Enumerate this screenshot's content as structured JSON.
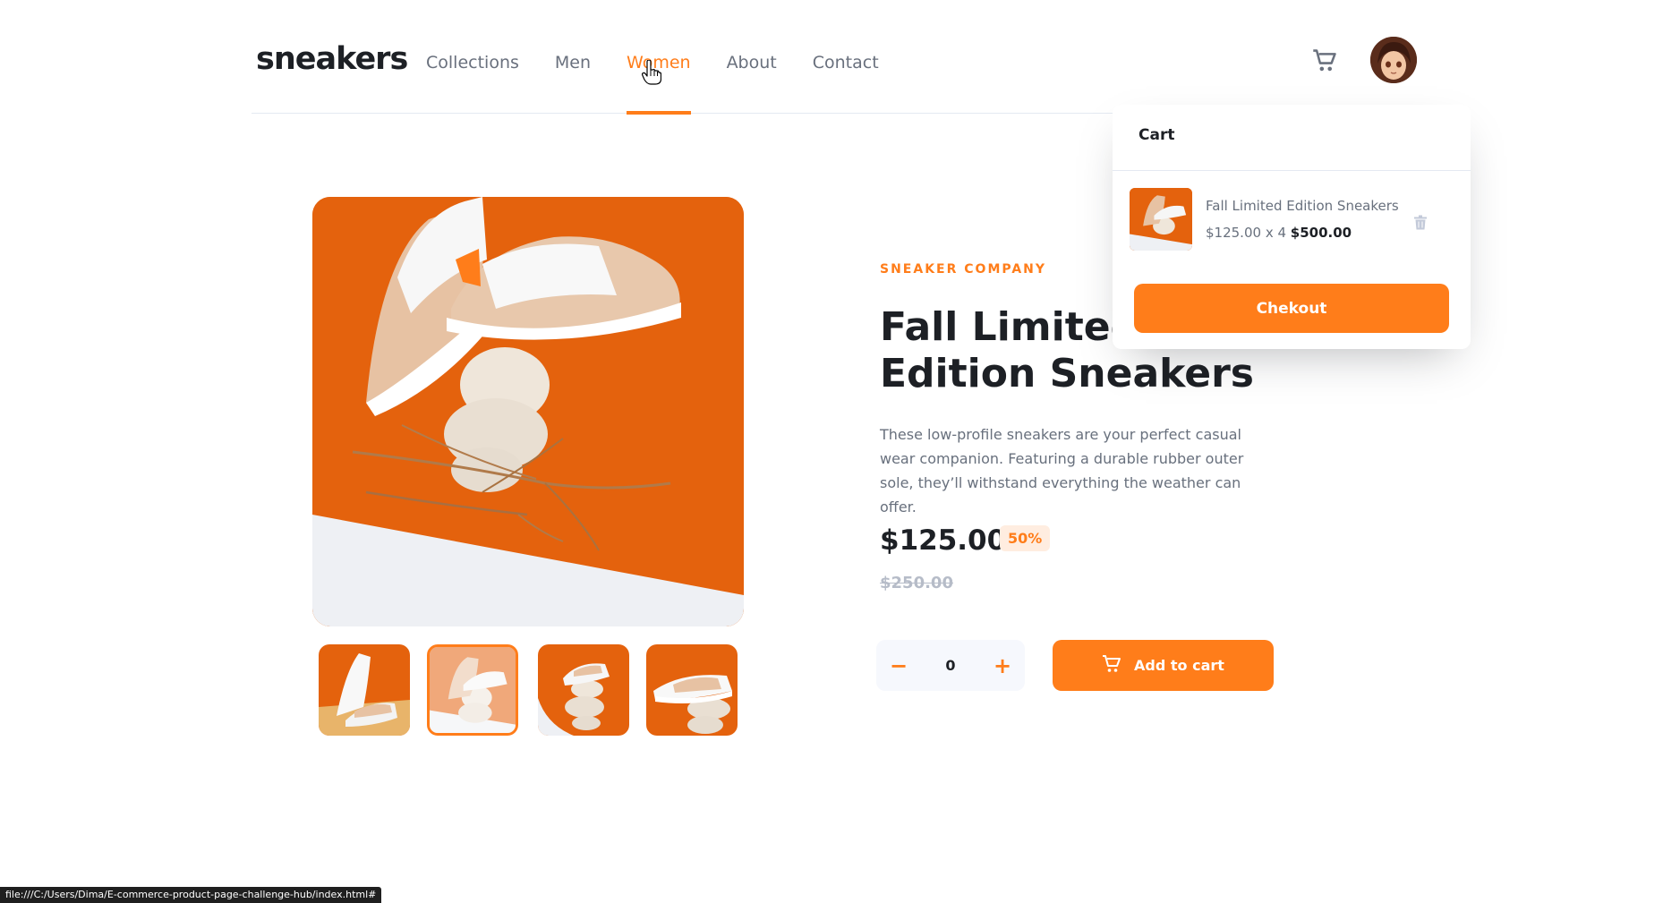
{
  "brand": {
    "logo": "sneakers"
  },
  "nav": {
    "items": [
      {
        "label": "Collections"
      },
      {
        "label": "Men"
      },
      {
        "label": "Women"
      },
      {
        "label": "About"
      },
      {
        "label": "Contact"
      }
    ],
    "active": "Women"
  },
  "product": {
    "company": "SNEAKER COMPANY",
    "title": "Fall Limited Edition Sneakers",
    "description": "These low-profile sneakers are your perfect casual wear companion. Featuring a durable rubber outer sole, they’ll withstand everything the weather can offer.",
    "price": "$125.00",
    "discount": "50%",
    "old_price": "$250.00",
    "selected_thumbnail": 2
  },
  "quantity": {
    "value": "0",
    "minus": "−",
    "plus": "+"
  },
  "actions": {
    "add_to_cart": "Add to cart"
  },
  "cart": {
    "title": "Cart",
    "item": {
      "name": "Fall Limited Edition Sneakers",
      "unit_price": "$125.00",
      "multiplier": "x 4",
      "total": "$500.00"
    },
    "checkout": "Chekout"
  },
  "status_bar": {
    "url": "file:///C:/Users/Dima/E-commerce-product-page-challenge-hub/index.html#"
  },
  "colors": {
    "accent": "#ff7d1a",
    "accent_pale": "#ffede0",
    "text_dark": "#1d2025",
    "text_muted": "#68707d"
  }
}
